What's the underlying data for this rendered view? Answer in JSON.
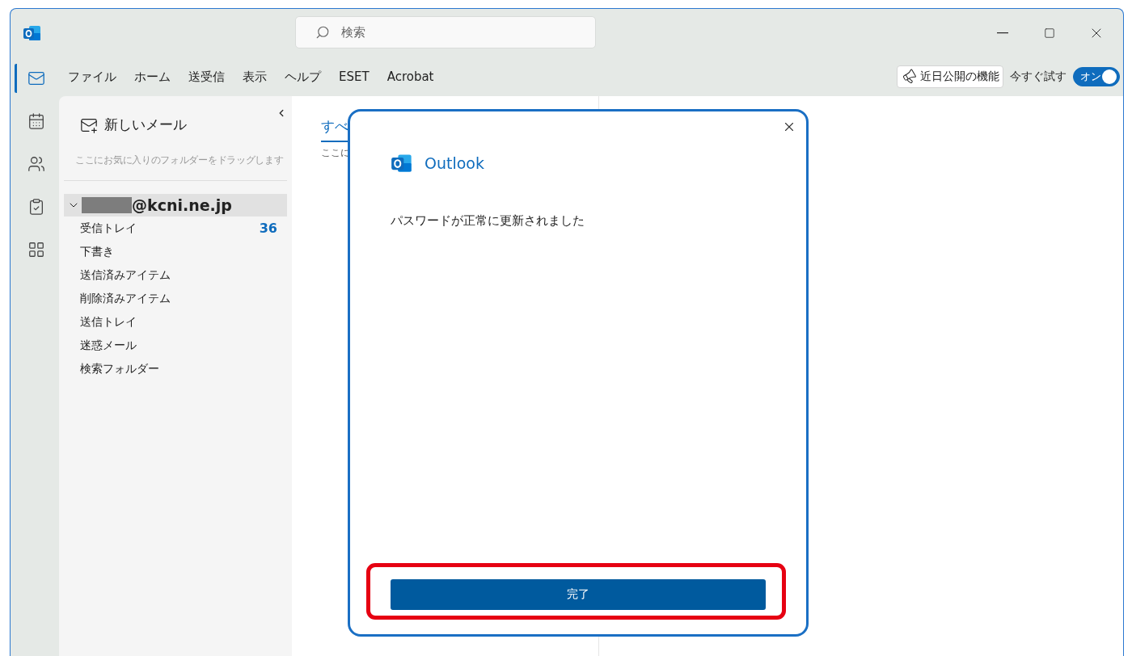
{
  "window": {
    "search": {
      "placeholder": "検索"
    }
  },
  "menu": [
    {
      "label": "ファイル"
    },
    {
      "label": "ホーム"
    },
    {
      "label": "送受信"
    },
    {
      "label": "表示"
    },
    {
      "label": "ヘルプ"
    },
    {
      "label": "ESET"
    },
    {
      "label": "Acrobat"
    }
  ],
  "upcoming_features": {
    "label": "近日公開の機能"
  },
  "try_now": {
    "label": "今すぐ試す",
    "toggle": {
      "label": "オン",
      "on": true
    }
  },
  "rail": [
    {
      "kind": "mail",
      "selected": true
    },
    {
      "kind": "calendar",
      "selected": false
    },
    {
      "kind": "people",
      "selected": false
    },
    {
      "kind": "tasks",
      "selected": false
    },
    {
      "kind": "apps",
      "selected": false
    }
  ],
  "folder_pane": {
    "new_mail": "新しいメール",
    "favorites_hint": "ここにお気に入りのフォルダーをドラッグします",
    "account": {
      "name": "@kcni.ne.jp",
      "redacted": true,
      "expanded": true,
      "selected": true,
      "folders": [
        {
          "name": "受信トレイ",
          "count": "36"
        },
        {
          "name": "下書き"
        },
        {
          "name": "送信済みアイテム"
        },
        {
          "name": "削除済みアイテム"
        },
        {
          "name": "送信トレイ"
        },
        {
          "name": "迷惑メール"
        },
        {
          "name": "検索フォルダー"
        }
      ]
    }
  },
  "message_list": {
    "tab": "すべ",
    "hint": "ここに"
  },
  "dialog": {
    "app": "Outlook",
    "message": "パスワードが正常に更新されました",
    "button": {
      "label": "完了",
      "highlighted": true
    }
  }
}
